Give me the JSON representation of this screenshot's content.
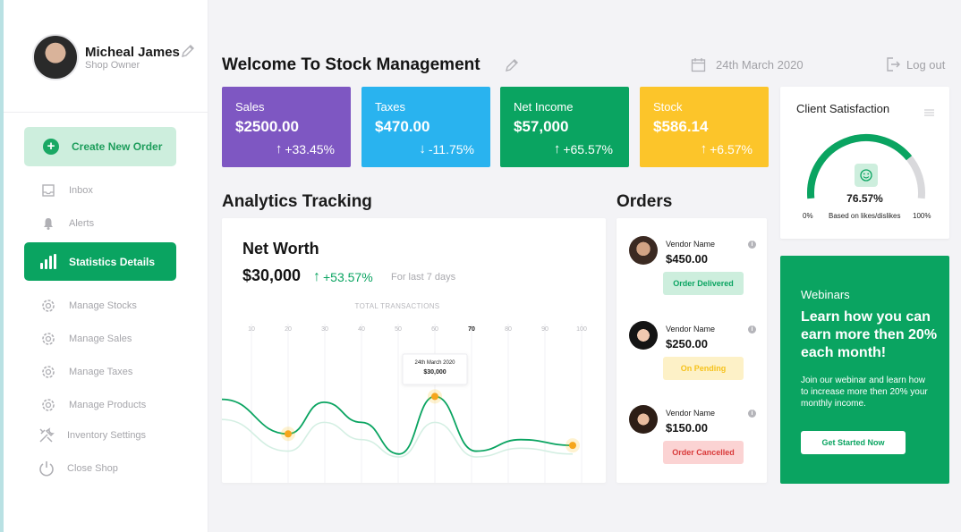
{
  "profile": {
    "name": "Micheal James",
    "role": "Shop Owner"
  },
  "sidebar": {
    "create_label": "Create New Order",
    "items": [
      {
        "label": "Inbox",
        "icon": "inbox-icon"
      },
      {
        "label": "Alerts",
        "icon": "bell-icon"
      },
      {
        "label": "Statistics Details",
        "icon": "bar-chart-icon",
        "active": true
      },
      {
        "label": "Manage Stocks",
        "icon": "gear-icon"
      },
      {
        "label": "Manage Sales",
        "icon": "gear-icon"
      },
      {
        "label": "Manage Taxes",
        "icon": "gear-icon"
      },
      {
        "label": "Manage Products",
        "icon": "gear-icon"
      },
      {
        "label": "Inventory Settings",
        "icon": "tools-icon"
      },
      {
        "label": "Close Shop",
        "icon": "power-icon"
      }
    ]
  },
  "header": {
    "title": "Welcome To Stock Management",
    "date": "24th March 2020",
    "logout": "Log out"
  },
  "stats": [
    {
      "label": "Sales",
      "value": "$2500.00",
      "change": "+33.45%",
      "direction": "up",
      "color": "#7e57c2"
    },
    {
      "label": "Taxes",
      "value": "$470.00",
      "change": "-11.75%",
      "direction": "down",
      "color": "#29b3ef"
    },
    {
      "label": "Net Income",
      "value": "$57,000",
      "change": "+65.57%",
      "direction": "up",
      "color": "#0aa461"
    },
    {
      "label": "Stock",
      "value": "$586.14",
      "change": "+6.57%",
      "direction": "up",
      "color": "#fcc52a"
    }
  ],
  "satisfaction": {
    "title": "Client Satisfaction",
    "value_label": "76.57%",
    "fraction": 0.7657,
    "min_label": "0%",
    "max_label": "100%",
    "caption": "Based on likes/dislikes"
  },
  "analytics": {
    "section_title": "Analytics Tracking",
    "card_title": "Net Worth",
    "value": "$30,000",
    "change": "+53.57%",
    "period": "For last 7 days",
    "caption": "TOTAL TRANSACTIONS",
    "tooltip_date": "24th March 2020",
    "tooltip_value": "$30,000"
  },
  "chart_data": {
    "type": "line",
    "categories": [
      "10",
      "20",
      "30",
      "40",
      "50",
      "60",
      "70",
      "80",
      "90",
      "100"
    ],
    "highlighted_category": "70",
    "series": [
      {
        "values": [
          58,
          34,
          56,
          42,
          20,
          60,
          22,
          30,
          26
        ]
      },
      {
        "values": [
          44,
          22,
          42,
          30,
          18,
          42,
          18,
          24,
          20
        ]
      }
    ],
    "ylim": [
      0,
      100
    ],
    "grid": true
  },
  "orders": {
    "section_title": "Orders",
    "items": [
      {
        "vendor": "Vendor Name",
        "amount": "$450.00",
        "status": "Order Delivered",
        "status_color": "#0aa461",
        "status_bg": "#cdeedd"
      },
      {
        "vendor": "Vendor Name",
        "amount": "$250.00",
        "status": "On Pending",
        "status_color": "#f6c21c",
        "status_bg": "#fdf1c7"
      },
      {
        "vendor": "Vendor Name",
        "amount": "$150.00",
        "status": "Order Cancelled",
        "status_color": "#d93a3a",
        "status_bg": "#fbd3d3"
      }
    ]
  },
  "webinar": {
    "label": "Webinars",
    "headline": "Learn how you can earn more then 20% each month!",
    "body": "Join our webinar and learn how to increase more then 20% your monthly income.",
    "button": "Get Started Now"
  }
}
